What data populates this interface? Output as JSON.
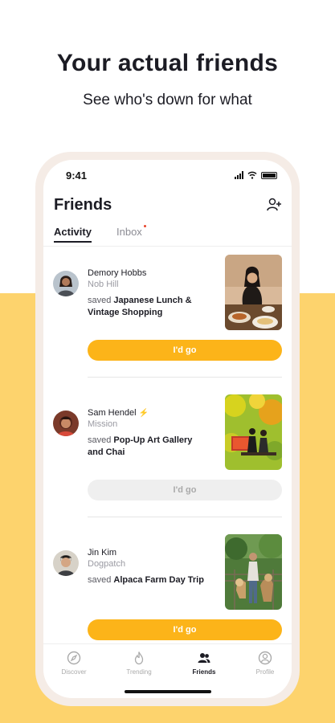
{
  "promo": {
    "headline": "Your actual friends",
    "subline": "See who's down for what"
  },
  "status_bar": {
    "time": "9:41"
  },
  "header": {
    "title": "Friends",
    "add_friend_icon": "add-person-icon"
  },
  "tabs": [
    {
      "label": "Activity",
      "active": true
    },
    {
      "label": "Inbox",
      "active": false,
      "unread": true
    }
  ],
  "feed": [
    {
      "name": "Demory Hobbs",
      "neighborhood": "Nob Hill",
      "saved_verb": "saved",
      "plan": "Japanese Lunch & Vintage Shopping",
      "button_label": "I'd go",
      "button_state": "active",
      "badge": ""
    },
    {
      "name": "Sam Hendel",
      "neighborhood": "Mission",
      "saved_verb": "saved",
      "plan": "Pop-Up Art Gallery and Chai",
      "button_label": "I'd go",
      "button_state": "inactive",
      "badge": "⚡"
    },
    {
      "name": "Jin Kim",
      "neighborhood": "Dogpatch",
      "saved_verb": "saved",
      "plan": "Alpaca Farm Day Trip",
      "button_label": "I'd go",
      "button_state": "active",
      "badge": ""
    }
  ],
  "bottom_nav": [
    {
      "label": "Discover",
      "icon": "compass-icon",
      "active": false
    },
    {
      "label": "Trending",
      "icon": "flame-icon",
      "active": false
    },
    {
      "label": "Friends",
      "icon": "people-icon",
      "active": true
    },
    {
      "label": "Profile",
      "icon": "profile-icon",
      "active": false
    }
  ],
  "colors": {
    "accent_yellow": "#fcb419",
    "background_yellow": "#fdd36d",
    "inbox_dot": "#e8452c"
  }
}
